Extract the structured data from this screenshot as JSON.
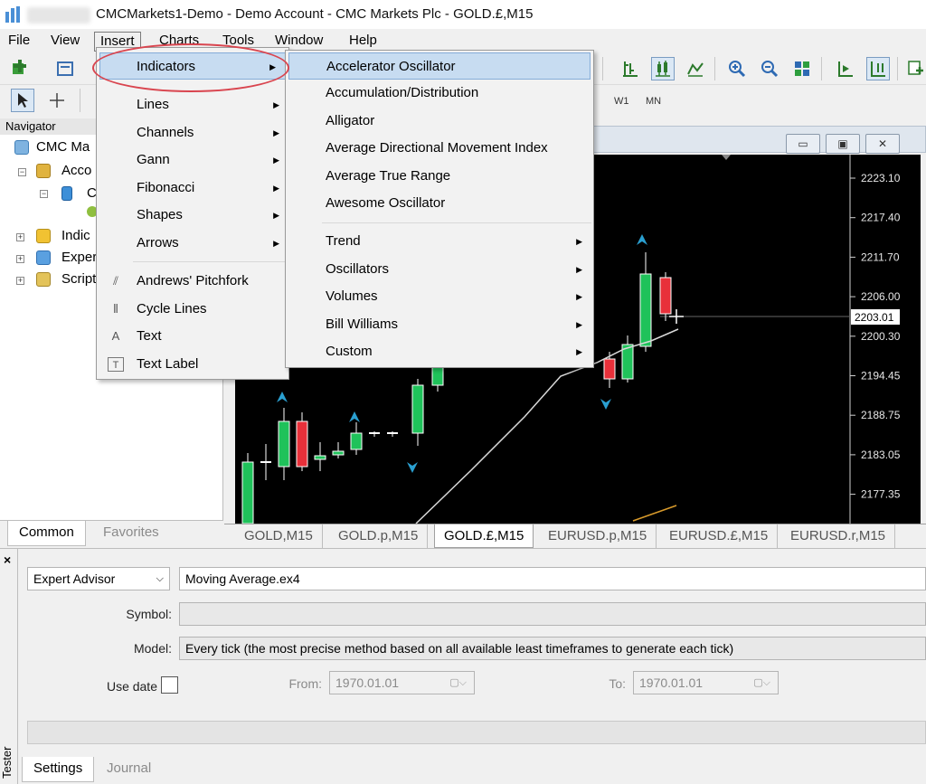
{
  "window": {
    "title": "CMCMarkets1-Demo - Demo Account - CMC Markets Plc - GOLD.£,M15"
  },
  "menubar": {
    "items": [
      "File",
      "View",
      "Insert",
      "Charts",
      "Tools",
      "Window",
      "Help"
    ]
  },
  "toolbar": {
    "timeframes": [
      "W1",
      "MN"
    ]
  },
  "navigator": {
    "title": "Navigator",
    "items": [
      "CMC Ma",
      "Acco",
      "C",
      "Indic",
      "Exper",
      "Script"
    ],
    "tabs": [
      "Common",
      "Favorites"
    ]
  },
  "insert_menu": {
    "items": [
      {
        "label": "Indicators",
        "submenu": true,
        "highlighted": true
      },
      {
        "label": "Lines",
        "submenu": true
      },
      {
        "label": "Channels",
        "submenu": true
      },
      {
        "label": "Gann",
        "submenu": true
      },
      {
        "label": "Fibonacci",
        "submenu": true
      },
      {
        "label": "Shapes",
        "submenu": true
      },
      {
        "label": "Arrows",
        "submenu": true
      },
      {
        "label": "Andrews' Pitchfork",
        "icon": "pitchfork-icon"
      },
      {
        "label": "Cycle Lines",
        "icon": "cycle-lines-icon"
      },
      {
        "label": "Text",
        "icon": "text-icon"
      },
      {
        "label": "Text Label",
        "icon": "text-label-icon"
      }
    ]
  },
  "indicators_menu": {
    "items": [
      {
        "label": "Accelerator Oscillator",
        "highlighted": true
      },
      {
        "label": "Accumulation/Distribution"
      },
      {
        "label": "Alligator"
      },
      {
        "label": "Average Directional Movement Index"
      },
      {
        "label": "Average True Range"
      },
      {
        "label": "Awesome Oscillator"
      },
      {
        "label": "Trend",
        "submenu": true
      },
      {
        "label": "Oscillators",
        "submenu": true
      },
      {
        "label": "Volumes",
        "submenu": true
      },
      {
        "label": "Bill Williams",
        "submenu": true
      },
      {
        "label": "Custom",
        "submenu": true
      }
    ]
  },
  "chart": {
    "price_labels": [
      "2223.10",
      "2217.40",
      "2211.70",
      "2206.00",
      "2200.30",
      "2194.45",
      "2188.75",
      "2183.05",
      "2177.35"
    ],
    "current_price": "2203.01",
    "tabs": [
      "GOLD,M15",
      "GOLD.p,M15",
      "GOLD.£,M15",
      "EURUSD.p,M15",
      "EURUSD.£,M15",
      "EURUSD.r,M15"
    ],
    "active_tab": "GOLD.£,M15",
    "colors": {
      "bull": "#1fc25a",
      "bear": "#e8303a",
      "ma": "#d9d9d9",
      "arrow": "#2a9fd0"
    }
  },
  "tester": {
    "side_label": "Tester",
    "mode": "Expert Advisor",
    "expert": "Moving Average.ex4",
    "symbol_label": "Symbol:",
    "symbol_value": "",
    "model_label": "Model:",
    "model_value": "Every tick (the most precise method based on all available least timeframes to generate each tick)",
    "use_date_label": "Use date",
    "from_label": "From:",
    "from_value": "1970.01.01",
    "to_label": "To:",
    "to_value": "1970.01.01",
    "tabs": [
      "Settings",
      "Journal"
    ]
  }
}
